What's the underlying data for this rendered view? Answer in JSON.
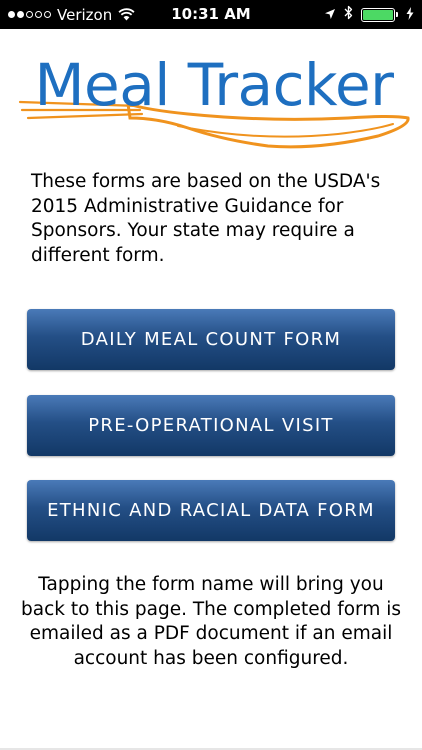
{
  "status_bar": {
    "carrier": "Verizon",
    "time": "10:31 AM",
    "signal_bars_filled": 2,
    "signal_bars_total": 5,
    "icons": [
      "wifi-icon",
      "location-arrow-icon",
      "bluetooth-icon",
      "battery-icon",
      "charging-bolt-icon"
    ],
    "battery_fill_fraction": 1.0,
    "battery_color": "#4cd964"
  },
  "logo": {
    "title": "Meal Tracker",
    "title_color": "#1e6fc0",
    "swoosh_color": "#f0931e"
  },
  "intro_text": "These forms are based on the USDA's 2015 Administrative Guidance for Sponsors. Your state may require a different form.",
  "buttons": [
    {
      "label": "DAILY MEAL COUNT FORM"
    },
    {
      "label": "PRE-OPERATIONAL VISIT"
    },
    {
      "label": "ETHNIC AND RACIAL DATA FORM"
    }
  ],
  "button_colors": {
    "top": "#4a7ab8",
    "bottom": "#123866"
  },
  "footer_text": "Tapping the form name will bring you back to this page. The completed form is emailed as a PDF document if an email account has been configured."
}
